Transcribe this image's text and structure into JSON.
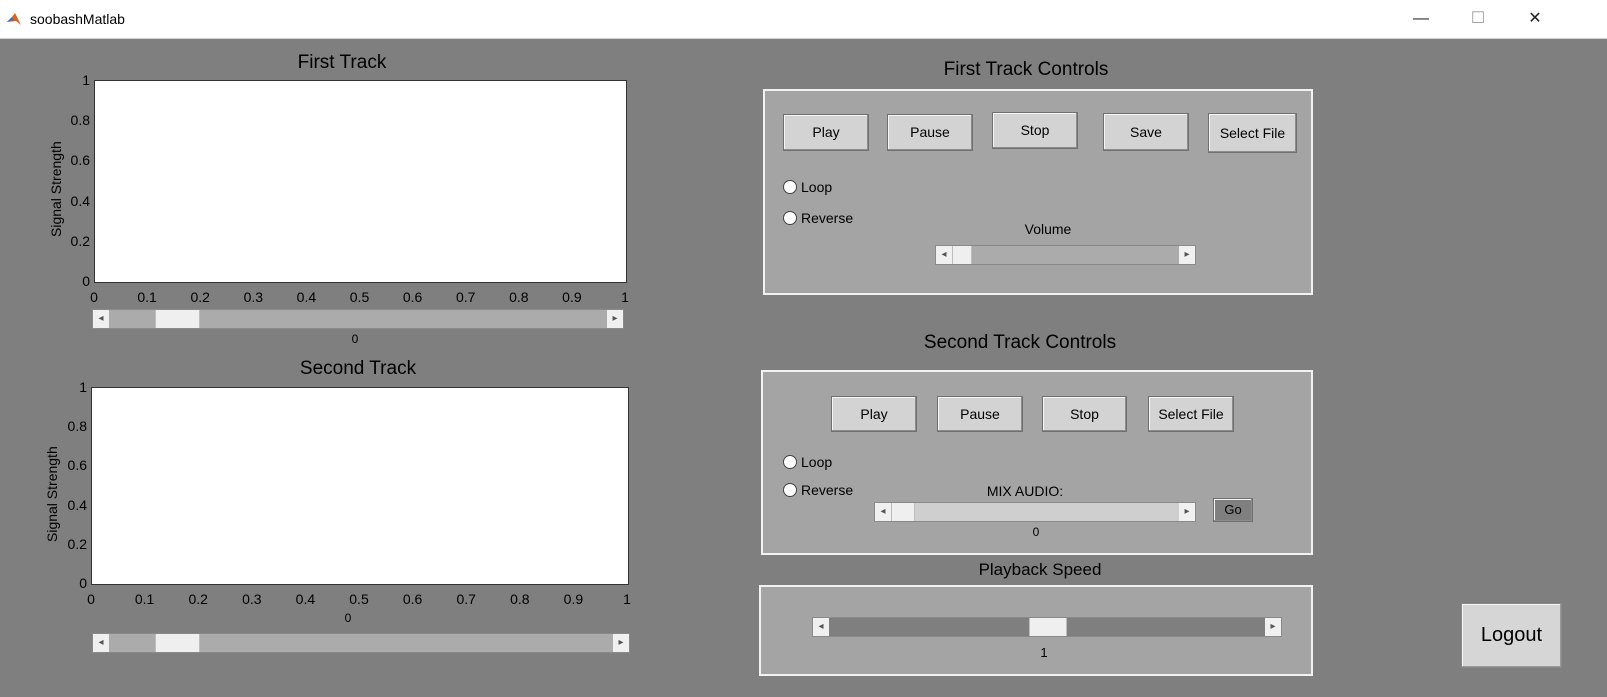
{
  "window": {
    "title": "soobashMatlab",
    "minimize": "—",
    "maximize": "☐",
    "close": "✕"
  },
  "track1": {
    "title": "First  Track",
    "ylabel": "Signal Strength",
    "yticks": [
      "1",
      "0.8",
      "0.6",
      "0.4",
      "0.2",
      "0"
    ],
    "xticks": [
      "0",
      "0.1",
      "0.2",
      "0.3",
      "0.4",
      "0.5",
      "0.6",
      "0.7",
      "0.8",
      "0.9",
      "1"
    ],
    "position_value": "0"
  },
  "track2": {
    "title": "Second Track",
    "ylabel": "Signal Strength",
    "yticks": [
      "1",
      "0.8",
      "0.6",
      "0.4",
      "0.2",
      "0"
    ],
    "xticks": [
      "0",
      "0.1",
      "0.2",
      "0.3",
      "0.4",
      "0.5",
      "0.6",
      "0.7",
      "0.8",
      "0.9",
      "1"
    ],
    "position_value": "0"
  },
  "controls1": {
    "title": "First Track Controls",
    "play": "Play",
    "pause": "Pause",
    "stop": "Stop",
    "save": "Save",
    "select_file": "Select File",
    "loop": "Loop",
    "reverse": "Reverse",
    "volume_label": "Volume"
  },
  "controls2": {
    "title": "Second Track Controls",
    "play": "Play",
    "pause": "Pause",
    "stop": "Stop",
    "select_file": "Select File",
    "loop": "Loop",
    "reverse": "Reverse",
    "mix_label": "MIX AUDIO:",
    "mix_value": "0",
    "go": "Go"
  },
  "playback": {
    "title": "Playback Speed",
    "value": "1"
  },
  "logout": "Logout",
  "colors": {
    "background": "#7f7f7f",
    "panel": "#a4a4a4",
    "button": "#d3d3d3"
  }
}
